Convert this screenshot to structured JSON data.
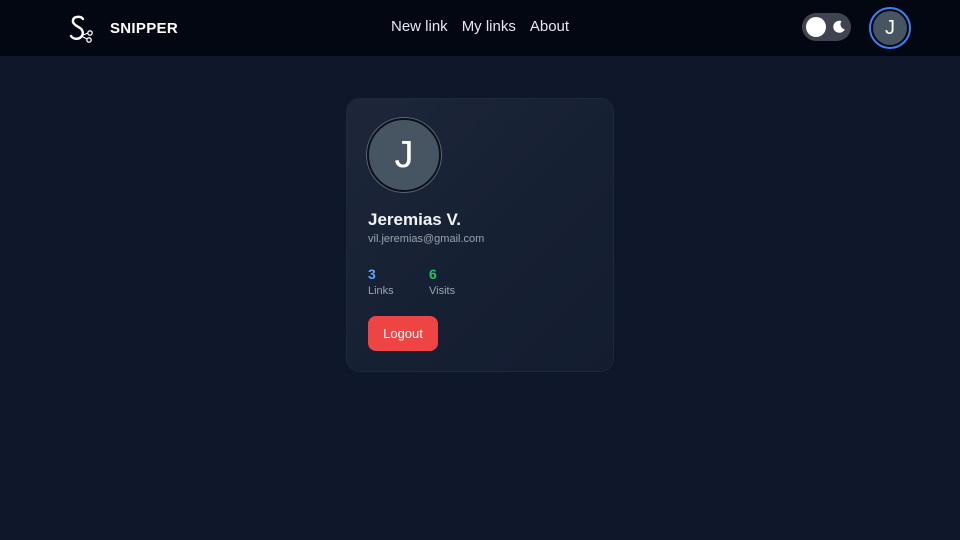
{
  "header": {
    "brand_name": "SNIPPER",
    "logo_icon": "scissors-s-logo-icon",
    "nav": [
      "New link",
      "My links",
      "About"
    ],
    "theme_toggle": {
      "state": "dark",
      "icon": "moon-icon"
    },
    "avatar_initial": "J"
  },
  "profile": {
    "avatar_initial": "J",
    "name": "Jeremias V.",
    "email": "vil.jeremias@gmail.com",
    "stats": [
      {
        "value": "3",
        "label": "Links",
        "color": "#60a5fa"
      },
      {
        "value": "6",
        "label": "Visits",
        "color": "#22c55e"
      }
    ],
    "logout_label": "Logout"
  },
  "colors": {
    "background": "#0f172a",
    "navbar": "#030712",
    "card": "#1a2436",
    "accent_blue": "#3b82f6",
    "danger": "#ef4444"
  }
}
